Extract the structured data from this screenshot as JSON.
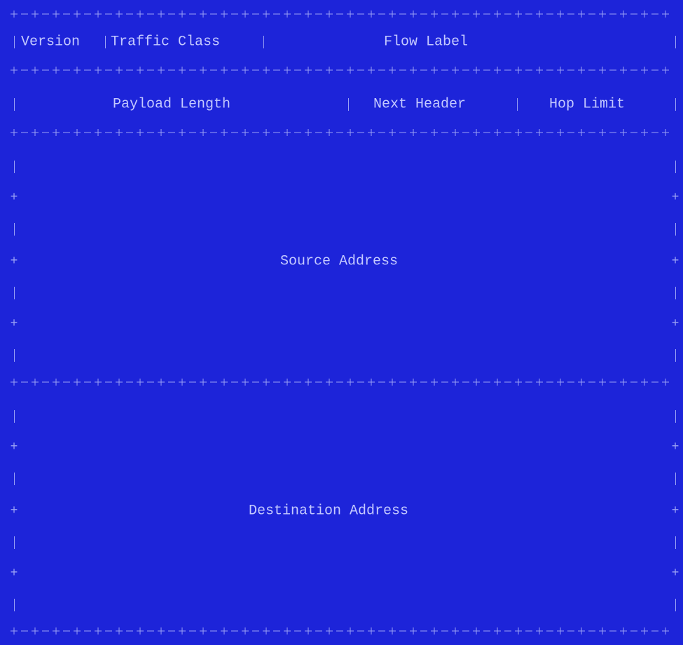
{
  "diagram": {
    "rows": {
      "r1": {
        "version": "Version",
        "traffic_class": "Traffic Class",
        "flow_label": "Flow Label"
      },
      "r2": {
        "payload_length": "Payload Length",
        "next_header": "Next Header",
        "hop_limit": "Hop Limit"
      },
      "source": {
        "label": "Source Address"
      },
      "destination": {
        "label": "Destination Address"
      }
    }
  },
  "colors": {
    "background": "#1d24d9",
    "text": "#c4c9ff",
    "lines": "#9aa1f5"
  }
}
